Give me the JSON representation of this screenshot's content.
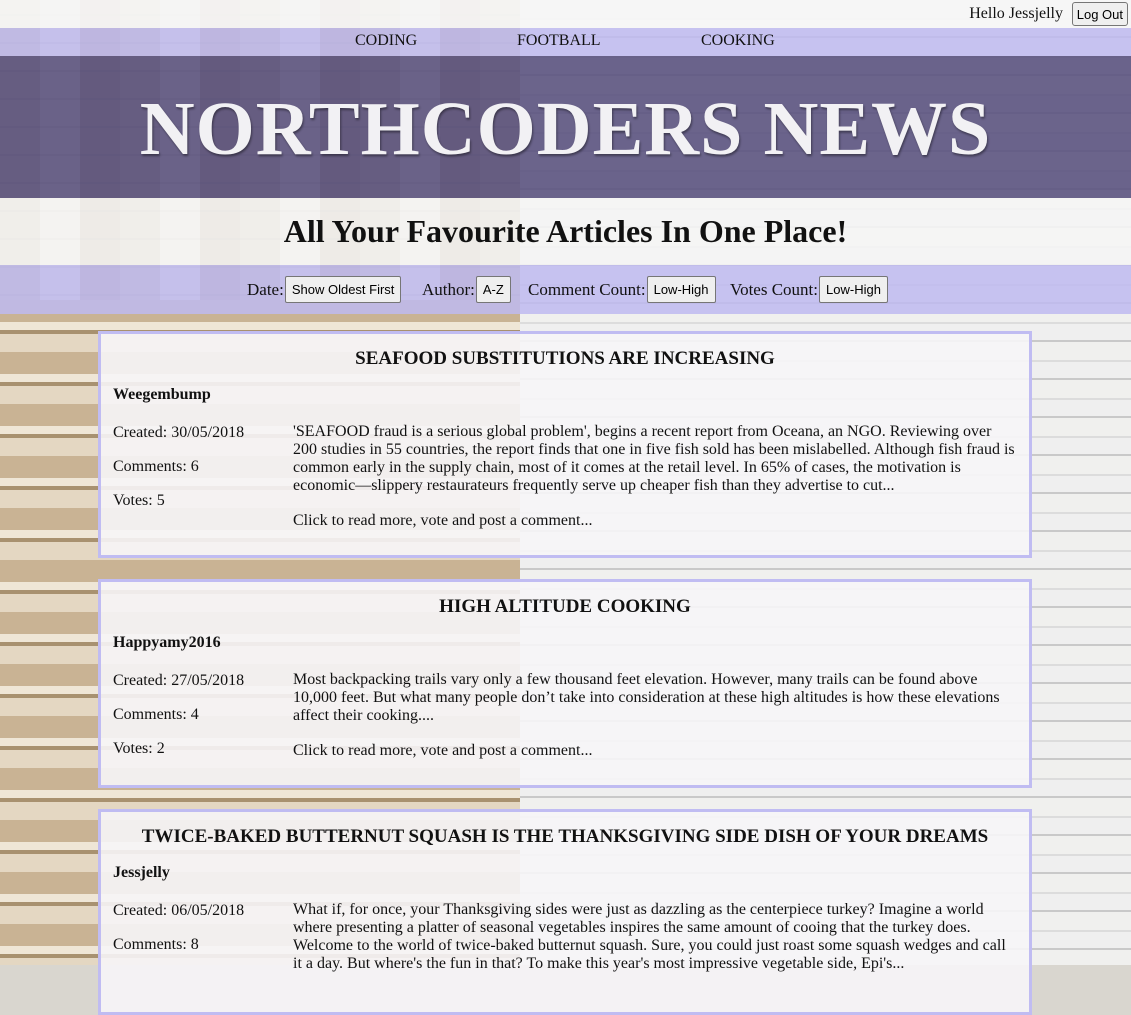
{
  "header": {
    "greeting": "Hello Jessjelly",
    "logout_label": "Log Out"
  },
  "nav": {
    "topics": [
      "CODING",
      "FOOTBALL",
      "COOKING"
    ]
  },
  "banner": {
    "title": "NORTHCODERS NEWS",
    "tagline": "All Your Favourite Articles In One Place!"
  },
  "sort": {
    "date_label": "Date:",
    "date_button": "Show Oldest First",
    "author_label": "Author:",
    "author_button": "A-Z",
    "comments_label": "Comment Count:",
    "comments_button": "Low-High",
    "votes_label": "Votes Count:",
    "votes_button": "Low-High"
  },
  "articles": [
    {
      "title": "SEAFOOD SUBSTITUTIONS ARE INCREASING",
      "author": "Weegembump",
      "created": "Created: 30/05/2018",
      "comments": "Comments: 6",
      "votes": "Votes: 5",
      "body": "'SEAFOOD fraud is a serious global problem', begins a recent report from Oceana, an NGO. Reviewing over 200 studies in 55 countries, the report finds that one in five fish sold has been mislabelled. Although fish fraud is common early in the supply chain, most of it comes at the retail level. In 65% of cases, the motivation is economic—slippery restaurateurs frequently serve up cheaper fish than they advertise to cut...",
      "more": "Click to read more, vote and post a comment..."
    },
    {
      "title": "HIGH ALTITUDE COOKING",
      "author": "Happyamy2016",
      "created": "Created: 27/05/2018",
      "comments": "Comments: 4",
      "votes": "Votes: 2",
      "body": "Most backpacking trails vary only a few thousand feet elevation. However, many trails can be found above 10,000 feet. But what many people don’t take into consideration at these high altitudes is how these elevations affect their cooking....",
      "more": "Click to read more, vote and post a comment..."
    },
    {
      "title": "TWICE-BAKED BUTTERNUT SQUASH IS THE THANKSGIVING SIDE DISH OF YOUR DREAMS",
      "author": "Jessjelly",
      "created": "Created: 06/05/2018",
      "comments": "Comments: 8",
      "body": "What if, for once, your Thanksgiving sides were just as dazzling as the centerpiece turkey? Imagine a world where presenting a platter of seasonal vegetables inspires the same amount of cooing that the turkey does. Welcome to the world of twice-baked butternut squash. Sure, you could just roast some squash wedges and call it a day. But where's the fun in that? To make this year's most impressive vegetable side, Epi's..."
    }
  ]
}
